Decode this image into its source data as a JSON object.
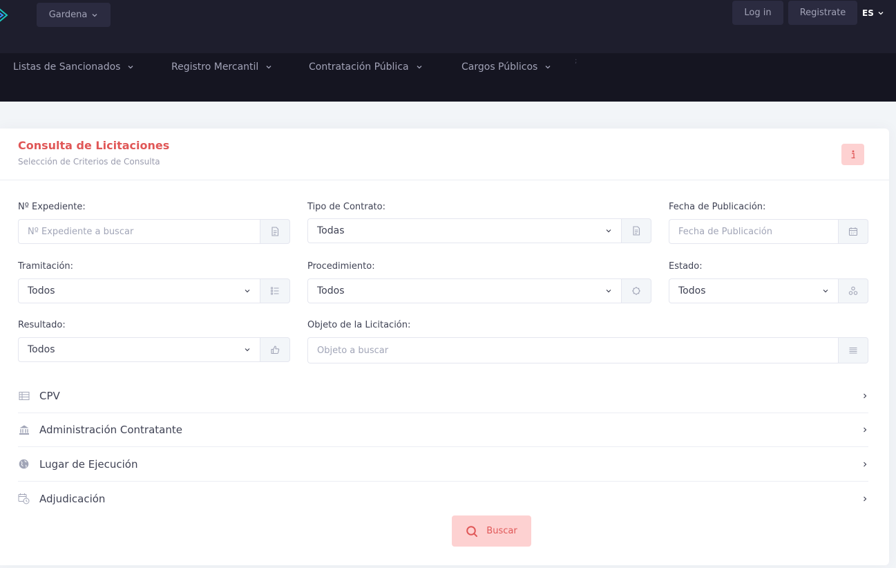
{
  "header": {
    "workspace_label": "Gardena",
    "login_label": "Log in",
    "register_label": "Registrate",
    "language": "ES"
  },
  "nav": {
    "items": [
      {
        "label": "Listas de Sancionados"
      },
      {
        "label": "Registro Mercantil"
      },
      {
        "label": "Contratación Pública"
      },
      {
        "label": "Cargos Públicos"
      }
    ],
    "separator": ";"
  },
  "card": {
    "title": "Consulta de Licitaciones",
    "subtitle": "Selección de Criterios de Consulta",
    "info_icon": "info-icon"
  },
  "form": {
    "expediente": {
      "label": "Nº Expediente:",
      "placeholder": "Nº Expediente a buscar",
      "icon": "document-icon"
    },
    "tipo_contrato": {
      "label": "Tipo de Contrato:",
      "value": "Todas",
      "icon": "document-icon"
    },
    "fecha_publicacion": {
      "label": "Fecha de Publicación:",
      "placeholder": "Fecha de Publicación",
      "icon": "calendar-icon"
    },
    "tramitacion": {
      "label": "Tramitación:",
      "value": "Todos",
      "icon": "list-icon"
    },
    "procedimiento": {
      "label": "Procedimiento:",
      "value": "Todos",
      "icon": "cycle-icon"
    },
    "estado": {
      "label": "Estado:",
      "value": "Todos",
      "icon": "nodes-icon"
    },
    "resultado": {
      "label": "Resultado:",
      "value": "Todos",
      "icon": "thumbs-up-icon"
    },
    "objeto": {
      "label": "Objeto de la Licitación:",
      "placeholder": "Objeto a buscar",
      "icon": "text-lines-icon"
    }
  },
  "accordion": [
    {
      "label": "CPV",
      "icon": "table-icon"
    },
    {
      "label": "Administración Contratante",
      "icon": "bank-icon"
    },
    {
      "label": "Lugar de Ejecución",
      "icon": "globe-icon"
    },
    {
      "label": "Adjudicación",
      "icon": "calendar-clock-icon"
    }
  ],
  "search_button": {
    "label": "Buscar",
    "icon": "search-icon"
  },
  "colors": {
    "topbar": "#1e1e2d",
    "navbar": "#151521",
    "accent": "#e05757",
    "accent_light": "#fdd1d1",
    "logo": "#1bc5bd"
  }
}
